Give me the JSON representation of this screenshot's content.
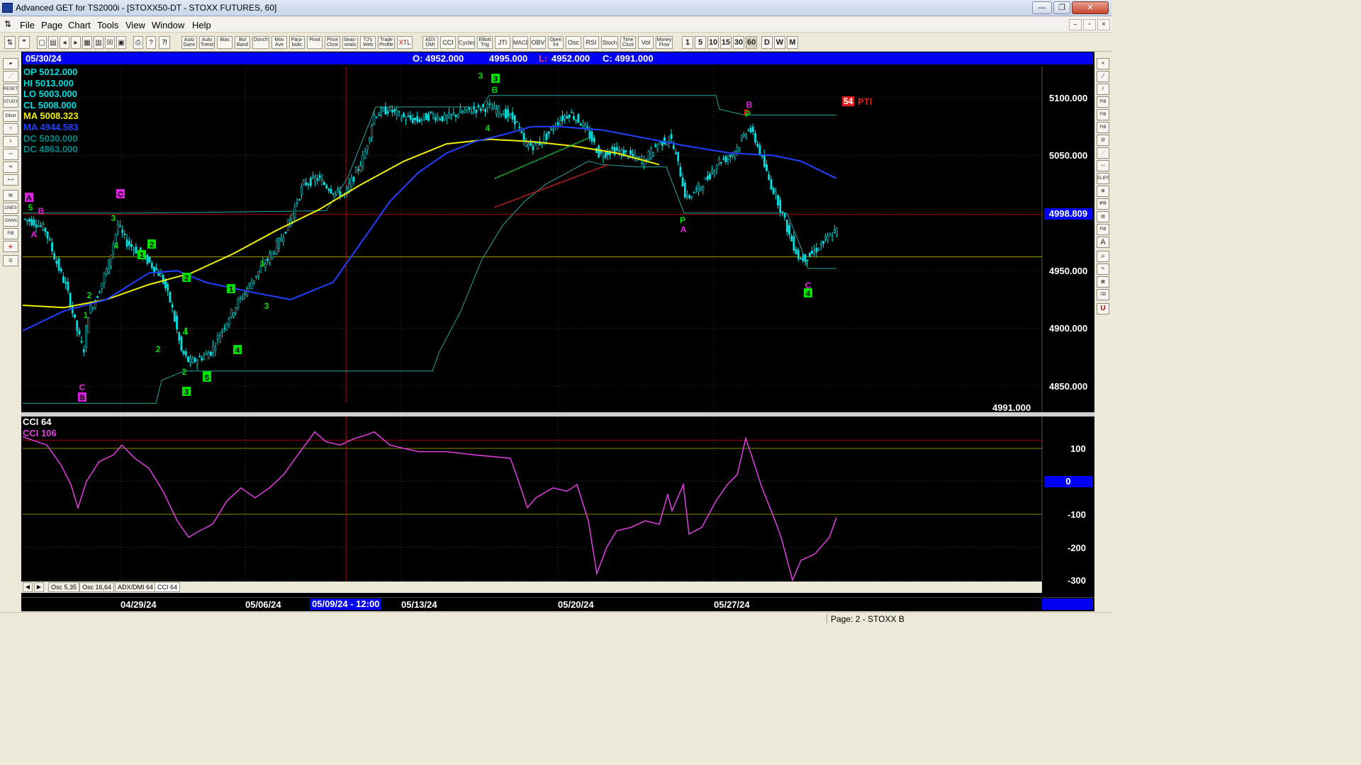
{
  "window": {
    "title": "Advanced GET for TS2000i - [STOXX50-DT - STOXX FUTURES, 60]",
    "minimize": "—",
    "maximize": "❐",
    "close": "✕"
  },
  "menu": {
    "items": [
      "File",
      "Page",
      "Chart",
      "Tools",
      "View",
      "Window",
      "Help"
    ]
  },
  "toolbar": {
    "studies": [
      "Auto Gann",
      "Auto Trend",
      "Bias",
      "Bol Band",
      "Donch",
      "Mov Ave",
      "Para-bolic",
      "Pivot",
      "Price Clust",
      "Seas-onals",
      "TJ's Web",
      "Trade Profile",
      "XTL",
      "ADX DMI",
      "CCI",
      "Cycles",
      "Elliott Trig",
      "JTI",
      "MACD",
      "OBV",
      "Open Int",
      "Osc",
      "RSI",
      "Stoch",
      "Time Clust",
      "Vol",
      "Money Flow"
    ],
    "timeframes": [
      "1",
      "5",
      "10",
      "15",
      "30",
      "60",
      "D",
      "W",
      "M"
    ]
  },
  "chart": {
    "header": {
      "date": "05/30/24",
      "open": "O: 4952.000",
      "high": "4995.000",
      "low_prefix": "L:",
      "low": "4952.000",
      "close": "C: 4991.000"
    },
    "info_panel": [
      {
        "label": "OP",
        "value": "5012.000",
        "color": "#00e0e0"
      },
      {
        "label": "HI",
        "value": "5013.000",
        "color": "#00e0e0"
      },
      {
        "label": "LO",
        "value": "5003.000",
        "color": "#00e0e0"
      },
      {
        "label": "CL",
        "value": "5008.000",
        "color": "#00e0e0"
      },
      {
        "label": "MA",
        "value": "5008.323",
        "color": "#f0f000"
      },
      {
        "label": "MA",
        "value": "4944.583",
        "color": "#2040ff"
      },
      {
        "label": "DC",
        "value": "5030.000",
        "color": "#008b8b"
      },
      {
        "label": "DC",
        "value": "4863.000",
        "color": "#008b8b"
      }
    ],
    "price_axis": [
      "5100.000",
      "5050.000",
      "4950.000",
      "4900.000",
      "4850.000"
    ],
    "current_price": "4998.809",
    "last_close": "4991.000",
    "pti_badge": "54",
    "pti_label": "PTI",
    "cci_pane": {
      "title": "CCI 64",
      "value_label": "CCI 106",
      "axis": [
        "100",
        "-100",
        "-200",
        "-300"
      ],
      "zero": "0"
    },
    "tabs": [
      "Osc 5,35",
      "Osc 16,64",
      "ADX/DMI 64",
      "CCI 64"
    ],
    "active_tab": "CCI 64",
    "date_axis": [
      "04/29/24",
      "05/06/24",
      "05/13/24",
      "05/20/24",
      "05/27/24"
    ],
    "crosshair_date": "05/09/24 - 12:00",
    "colors": {
      "background": "#000000",
      "candles": "#00e0e0",
      "ma_fast": "#f0f000",
      "ma_slow": "#2040ff",
      "donchian": "#2aa6a0",
      "cci": "#e040e0",
      "wave_green": "#00e000",
      "wave_magenta": "#e020e0",
      "highlight": "#0000f5",
      "crosshair": "#c00000"
    },
    "wave_labels": {
      "green_boxed": [
        "3",
        "B",
        "2",
        "1",
        "2",
        "1",
        "4",
        "2",
        "3",
        "5",
        "4"
      ],
      "green_plain": [
        "3",
        "4",
        "5",
        "3",
        "4",
        "2",
        "1",
        "4",
        "2",
        "1",
        "3",
        "1",
        "2",
        "P",
        "P"
      ],
      "magenta_boxed": [
        "A",
        "C",
        "B",
        "C"
      ],
      "magenta_plain": [
        "B",
        "A",
        "C",
        "B",
        "A",
        "C",
        "P"
      ]
    }
  },
  "statusbar": {
    "page": "Page: 2 - STOXX B"
  }
}
